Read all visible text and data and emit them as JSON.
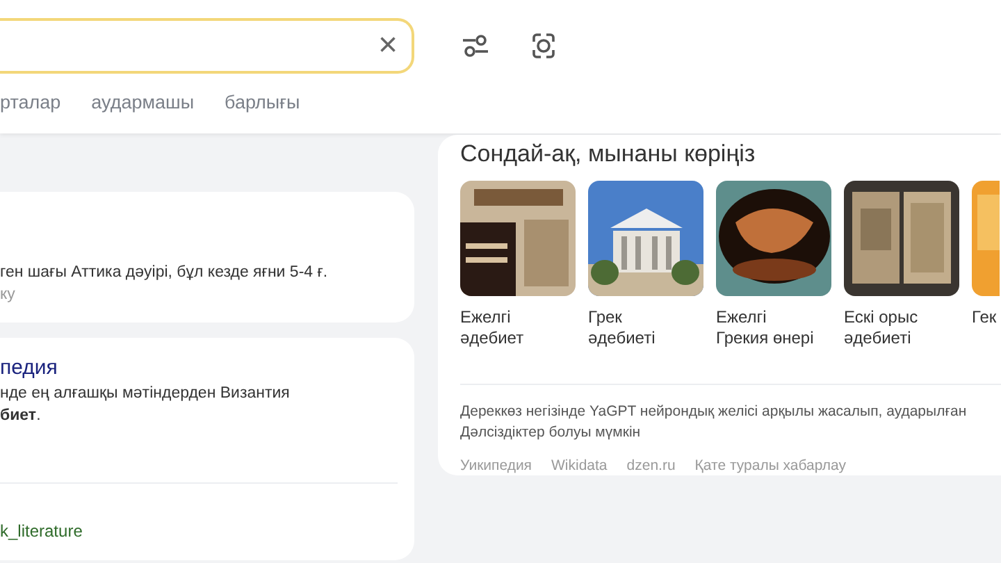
{
  "search": {
    "clear_icon": "×"
  },
  "tabs": [
    {
      "label": "рталар",
      "selected": false
    },
    {
      "label": "аудармашы",
      "selected": false
    },
    {
      "label": "барлығы",
      "selected": false
    }
  ],
  "results": [
    {
      "lines": [
        {
          "kind": "text",
          "text": "ген шағы Аттика дәуірі, бұл кезде яғни 5-4 ғ."
        },
        {
          "kind": "muted",
          "text": "ку"
        }
      ]
    },
    {
      "title": "педия",
      "lines": [
        {
          "kind": "text",
          "text": "нде ең алғашқы мәтіндерден Византия"
        },
        {
          "kind": "text",
          "text": "**биет**."
        },
        {
          "kind": "divider"
        },
        {
          "kind": "url",
          "text": "k_literature"
        }
      ]
    }
  ],
  "related": {
    "title": "Сондай-ақ, мынаны көріңіз",
    "items": [
      {
        "label": [
          "Ежелгі",
          "әдебиет"
        ],
        "kind": "picture"
      },
      {
        "label": [
          "Грек",
          "әдебиеті"
        ],
        "kind": "picture"
      },
      {
        "label": [
          "Ежелгі",
          "Грекия өнері"
        ],
        "kind": "picture"
      },
      {
        "label": [
          "Ескі орыс",
          "әдебиеті"
        ],
        "kind": "picture"
      },
      {
        "label": [
          "Гек"
        ],
        "kind": "picture"
      }
    ],
    "note": [
      "Дереккөз негізінде YaGPT нейрондық желісі арқылы жасалып, аударылған",
      "Дәлсіздіктер болуы мүмкін"
    ],
    "links": [
      "Уикипедия",
      "Wikidata",
      "dzen.ru",
      "Қате туралы хабарлау"
    ]
  }
}
